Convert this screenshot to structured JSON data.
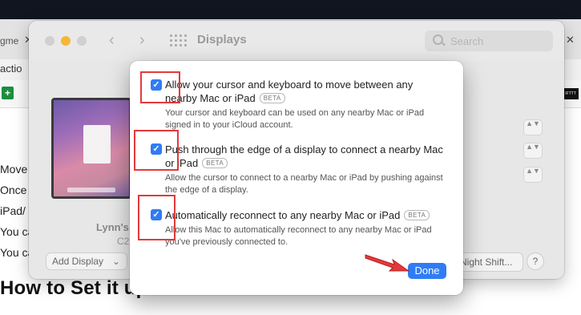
{
  "browser": {
    "tab_fragment": "gme",
    "tab_close": "✕",
    "right_tab_close": "✕",
    "toolbar_fragment": "actio",
    "sheets_icon": "+",
    "ifttt_label": "IFTTT"
  },
  "article": {
    "lines": [
      "Move",
      "Once",
      "iPad/",
      "You ca",
      "You ca"
    ],
    "heading": "How to Set it up:"
  },
  "prefs": {
    "title": "Displays",
    "search_placeholder": "Search",
    "nav_back": "‹",
    "nav_forward": "›",
    "display_name": "Lynn's",
    "display_sub": "C2",
    "add_display_label": "Add Display",
    "add_display_chevron": "⌄",
    "night_shift_label": "Night Shift...",
    "help_label": "?",
    "stepper_glyph": "▲▼"
  },
  "sheet": {
    "check_glyph": "✓",
    "options": [
      {
        "title": "Allow your cursor and keyboard to move between any nearby Mac or iPad",
        "badge": "BETA",
        "description": "Your cursor and keyboard can be used on any nearby Mac or iPad signed in to your iCloud account.",
        "checked": true
      },
      {
        "title": "Push through the edge of a display to connect a nearby Mac or iPad",
        "badge": "BETA",
        "description": "Allow the cursor to connect to a nearby Mac or iPad by pushing against the edge of a display.",
        "checked": true
      },
      {
        "title": "Automatically reconnect to any nearby Mac or iPad",
        "badge": "BETA",
        "description": "Allow this Mac to automatically reconnect to any nearby Mac or iPad you've previously connected to.",
        "checked": true
      }
    ],
    "done_label": "Done"
  },
  "colors": {
    "accent": "#2f7cf6",
    "annotation": "#e23a3a"
  },
  "icons": [
    "search-icon",
    "grid-icon",
    "checkbox-icon",
    "arrow-annotation-icon",
    "sheets-icon"
  ]
}
